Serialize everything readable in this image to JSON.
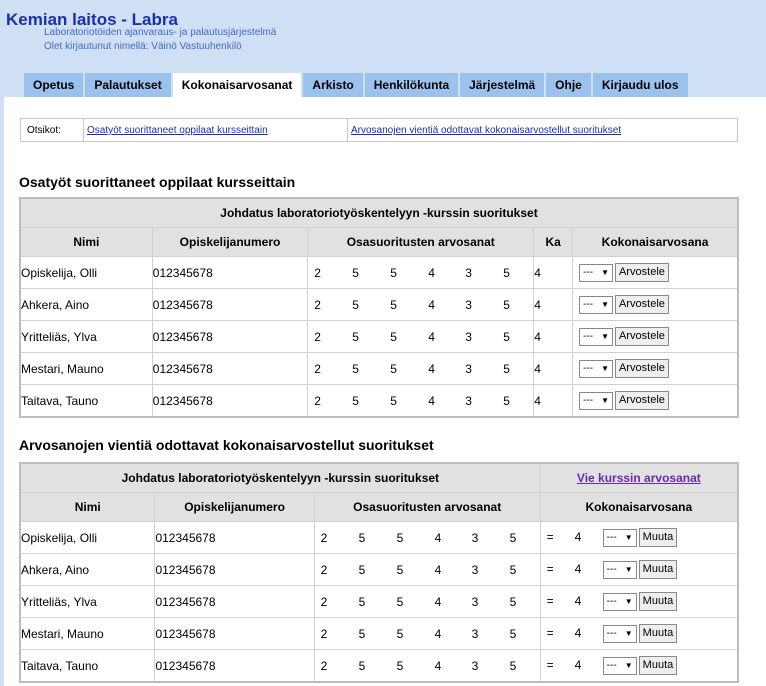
{
  "header": {
    "title": "Kemian laitos - Labra",
    "subtitle": "Laboratoriotöiden ajanvaraus- ja palautusjärjestelmä",
    "logged_in": "Olet kirjautunut nimellä: Väinö Vastuuhenkilö"
  },
  "tabs": [
    "Opetus",
    "Palautukset",
    "Kokonaisarvosanat",
    "Arkisto",
    "Henkilökunta",
    "Järjestelmä",
    "Ohje",
    "Kirjaudu ulos"
  ],
  "active_tab": "Kokonaisarvosanat",
  "otsikot": {
    "label": "Otsikot:",
    "link1": "Osatyöt suorittaneet oppilaat kursseittain",
    "link2": "Arvosanojen vientiä odottavat kokonaisarvostellut suoritukset"
  },
  "section1": {
    "heading": "Osatyöt suorittaneet oppilaat kursseittain",
    "table_title": "Johdatus laboratoriotyöskentelyyn -kurssin suoritukset",
    "columns": [
      "Nimi",
      "Opiskelijanumero",
      "Osasuoritusten arvosanat",
      "Ka",
      "Kokonaisarvosana"
    ],
    "select_value": "---",
    "button": "Arvostele",
    "rows": [
      {
        "name": "Opiskelija, Olli",
        "num": "012345678",
        "grades": [
          "2",
          "5",
          "5",
          "4",
          "3",
          "5"
        ],
        "ka": "4"
      },
      {
        "name": "Ahkera, Aino",
        "num": "012345678",
        "grades": [
          "2",
          "5",
          "5",
          "4",
          "3",
          "5"
        ],
        "ka": "4"
      },
      {
        "name": "Yritteliäs, Ylva",
        "num": "012345678",
        "grades": [
          "2",
          "5",
          "5",
          "4",
          "3",
          "5"
        ],
        "ka": "4"
      },
      {
        "name": "Mestari, Mauno",
        "num": "012345678",
        "grades": [
          "2",
          "5",
          "5",
          "4",
          "3",
          "5"
        ],
        "ka": "4"
      },
      {
        "name": "Taitava, Tauno",
        "num": "012345678",
        "grades": [
          "2",
          "5",
          "5",
          "4",
          "3",
          "5"
        ],
        "ka": "4"
      }
    ]
  },
  "section2": {
    "heading": "Arvosanojen vientiä odottavat kokonaisarvostellut suoritukset",
    "table_title": "Johdatus laboratoriotyöskentelyyn -kurssin suoritukset",
    "export_link": "Vie kurssin arvosanat",
    "columns": [
      "Nimi",
      "Opiskelijanumero",
      "Osasuoritusten arvosanat",
      "Kokonaisarvosana"
    ],
    "equals": "=",
    "select_value": "---",
    "button": "Muuta",
    "rows": [
      {
        "name": "Opiskelija, Olli",
        "num": "012345678",
        "grades": [
          "2",
          "5",
          "5",
          "4",
          "3",
          "5"
        ],
        "total": "4"
      },
      {
        "name": "Ahkera, Aino",
        "num": "012345678",
        "grades": [
          "2",
          "5",
          "5",
          "4",
          "3",
          "5"
        ],
        "total": "4"
      },
      {
        "name": "Yritteliäs, Ylva",
        "num": "012345678",
        "grades": [
          "2",
          "5",
          "5",
          "4",
          "3",
          "5"
        ],
        "total": "4"
      },
      {
        "name": "Mestari, Mauno",
        "num": "012345678",
        "grades": [
          "2",
          "5",
          "5",
          "4",
          "3",
          "5"
        ],
        "total": "4"
      },
      {
        "name": "Taitava, Tauno",
        "num": "012345678",
        "grades": [
          "2",
          "5",
          "5",
          "4",
          "3",
          "5"
        ],
        "total": "4"
      }
    ]
  }
}
